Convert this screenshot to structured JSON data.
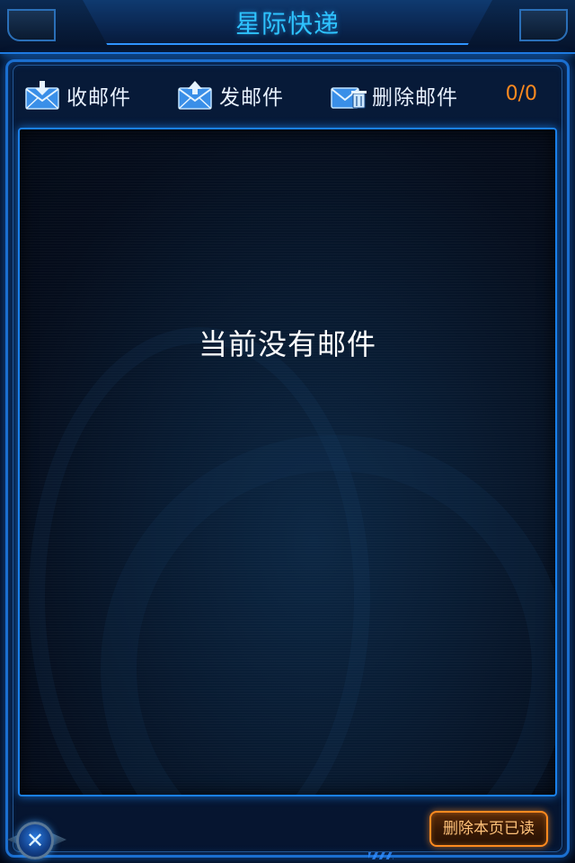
{
  "header": {
    "title": "星际快递"
  },
  "toolbar": {
    "receive_label": "收邮件",
    "send_label": "发邮件",
    "delete_label": "删除邮件",
    "mail_counter": "0/0"
  },
  "mail_list": {
    "empty_message": "当前没有邮件"
  },
  "footer": {
    "delete_read_label": "删除本页已读",
    "close_symbol": "✕"
  },
  "icons": {
    "receive": "mail-download-icon",
    "send": "mail-upload-icon",
    "delete": "mail-trash-icon",
    "close": "close-icon"
  },
  "colors": {
    "title_text": "#2ec3ff",
    "frame_accent": "#1b6fd0",
    "counter": "#ff8a1f",
    "button_border": "#ff8a1f"
  }
}
